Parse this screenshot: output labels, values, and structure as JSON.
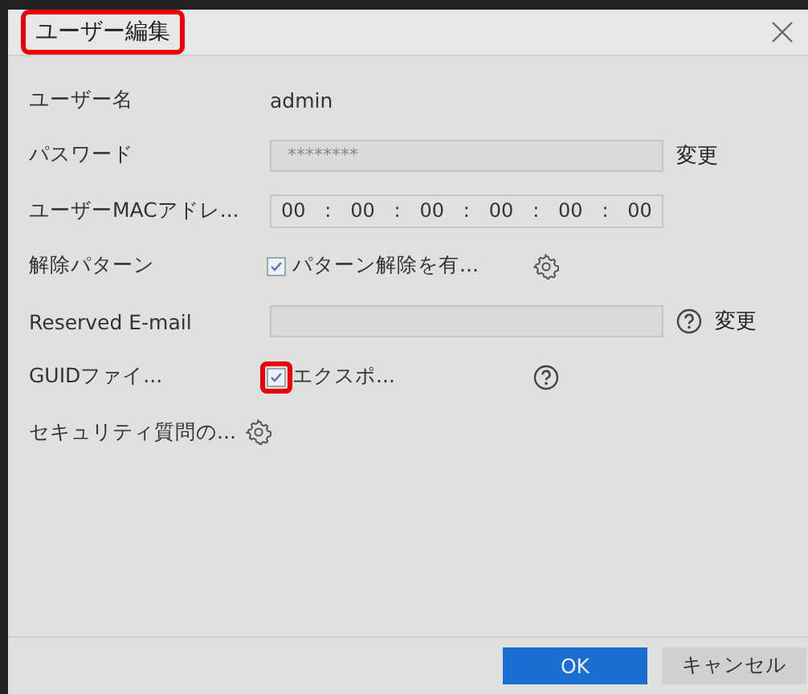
{
  "dialog": {
    "title": "ユーザー編集",
    "title_highlighted": true
  },
  "rows": [
    {
      "kind": "text",
      "label": "ユーザー名",
      "value": "admin"
    },
    {
      "kind": "field",
      "label": "パスワード",
      "value": "********",
      "link": "変更"
    },
    {
      "kind": "mac",
      "label": "ユーザーMACアドレ...",
      "parts": [
        "00",
        ":",
        "00",
        ":",
        "00",
        ":",
        "00",
        ":",
        "00",
        ":",
        "00"
      ]
    },
    {
      "kind": "checkbox_settings",
      "label": "解除パターン",
      "text": "パターン解除を有...",
      "checked": true,
      "highlighted": false
    },
    {
      "kind": "field_help",
      "label": "Reserved E-mail",
      "value": "",
      "link": "変更"
    },
    {
      "kind": "checkbox_help",
      "label": "GUIDファイ...",
      "text": "エクスポ...",
      "checked": true,
      "highlighted": true
    },
    {
      "kind": "gear",
      "label": "セキュリティ質問の..."
    }
  ],
  "buttons": [
    {
      "label": "OK",
      "primary": true
    },
    {
      "label": "キャンセル",
      "primary": false
    }
  ]
}
